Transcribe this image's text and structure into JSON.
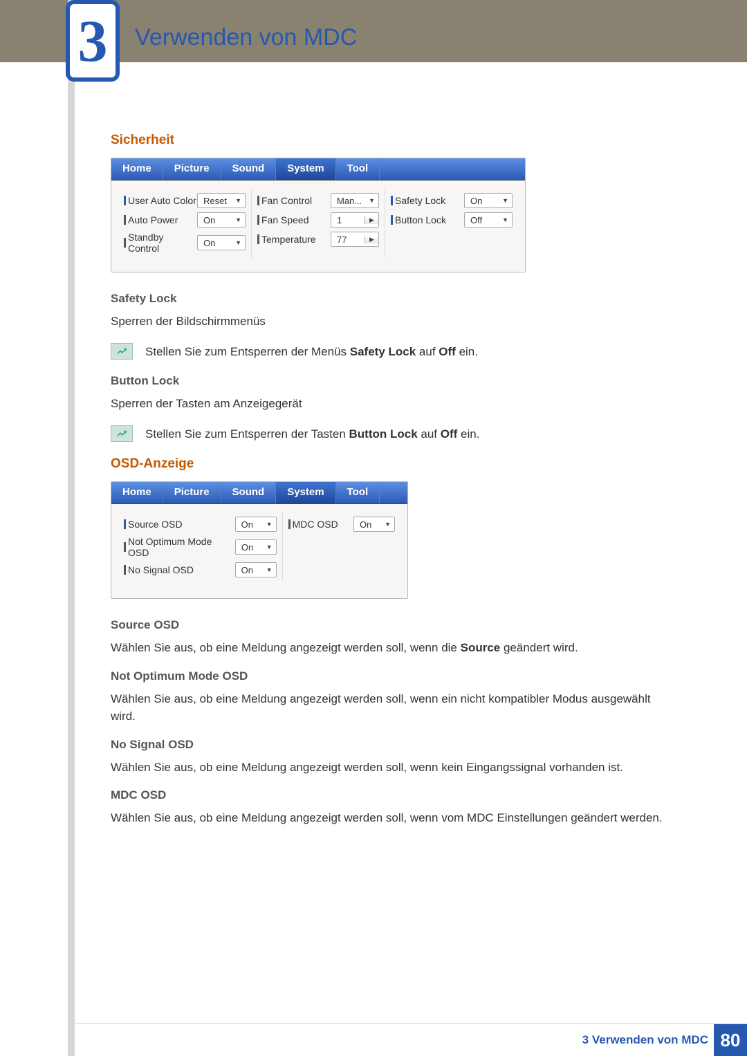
{
  "chapter": {
    "number": "3",
    "title": "Verwenden von MDC"
  },
  "section1": {
    "title": "Sicherheit"
  },
  "tabs": {
    "home": "Home",
    "picture": "Picture",
    "sound": "Sound",
    "system": "System",
    "tool": "Tool"
  },
  "panel1": {
    "col1": {
      "r1": {
        "label": "User Auto Color",
        "val": "Reset"
      },
      "r2": {
        "label": "Auto Power",
        "val": "On"
      },
      "r3": {
        "label": "Standby Control",
        "val": "On"
      }
    },
    "col2": {
      "r1": {
        "label": "Fan Control",
        "val": "Man..."
      },
      "r2": {
        "label": "Fan Speed",
        "val": "1"
      },
      "r3": {
        "label": "Temperature",
        "val": "77"
      }
    },
    "col3": {
      "r1": {
        "label": "Safety Lock",
        "val": "On"
      },
      "r2": {
        "label": "Button Lock",
        "val": "Off"
      }
    }
  },
  "safety_lock": {
    "h": "Safety Lock",
    "p": "Sperren der Bildschirmmenüs",
    "note_pre": "Stellen Sie zum Entsperren der Menüs ",
    "note_b": "Safety Lock",
    "note_mid": " auf ",
    "note_b2": "Off",
    "note_end": " ein."
  },
  "button_lock": {
    "h": "Button Lock",
    "p": "Sperren der Tasten am Anzeigegerät",
    "note_pre": "Stellen Sie zum Entsperren der Tasten ",
    "note_b": "Button Lock",
    "note_mid": " auf ",
    "note_b2": "Off",
    "note_end": " ein."
  },
  "section2": {
    "title": "OSD-Anzeige"
  },
  "panel2": {
    "col1": {
      "r1": {
        "label": "Source OSD",
        "val": "On"
      },
      "r2": {
        "label": "Not Optimum Mode OSD",
        "val": "On"
      },
      "r3": {
        "label": "No Signal OSD",
        "val": "On"
      }
    },
    "col2": {
      "r1": {
        "label": "MDC OSD",
        "val": "On"
      }
    }
  },
  "source_osd": {
    "h": "Source OSD",
    "p_pre": "Wählen Sie aus, ob eine Meldung angezeigt werden soll, wenn die ",
    "p_b": "Source",
    "p_end": " geändert wird."
  },
  "not_optimum": {
    "h": "Not Optimum Mode OSD",
    "p": "Wählen Sie aus, ob eine Meldung angezeigt werden soll, wenn ein nicht kompatibler Modus ausgewählt wird."
  },
  "no_signal": {
    "h": "No Signal OSD",
    "p": "Wählen Sie aus, ob eine Meldung angezeigt werden soll, wenn kein Eingangssignal vorhanden ist."
  },
  "mdc_osd": {
    "h": "MDC OSD",
    "p": "Wählen Sie aus, ob eine Meldung angezeigt werden soll, wenn vom MDC Einstellungen geändert werden."
  },
  "footer": {
    "text": "3 Verwenden von MDC",
    "page": "80"
  }
}
